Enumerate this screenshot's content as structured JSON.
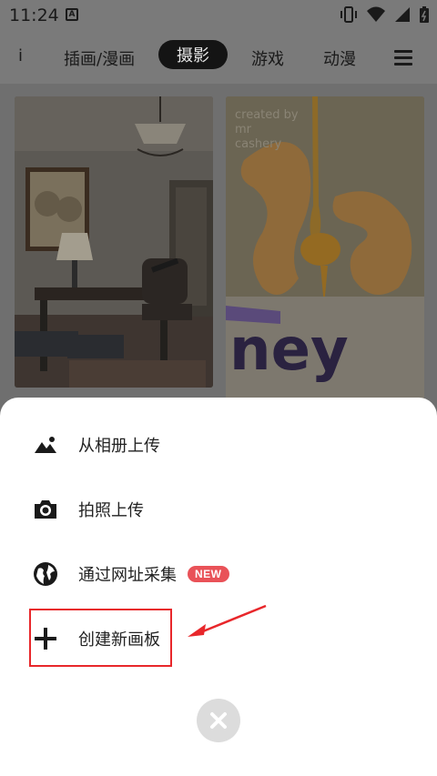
{
  "status_bar": {
    "time": "11:24",
    "notification_glyph": "A"
  },
  "tabs": {
    "partial_label": "i",
    "items": [
      {
        "label": "插画/漫画",
        "active": false
      },
      {
        "label": "摄影",
        "active": true
      },
      {
        "label": "游戏",
        "active": false
      },
      {
        "label": "动漫",
        "active": false
      }
    ]
  },
  "feed": {
    "cards": [
      {
        "kind": "photo",
        "subject": "study-room"
      },
      {
        "kind": "photo",
        "subject": "cashew-honey",
        "overlay_text": "created by\nmr\ncashery",
        "brand_text": "ney"
      }
    ]
  },
  "sheet": {
    "items": [
      {
        "label": "从相册上传",
        "icon": "image-mountain-icon"
      },
      {
        "label": "拍照上传",
        "icon": "camera-icon"
      },
      {
        "label": "通过网址采集",
        "icon": "globe-icon",
        "badge": "NEW"
      },
      {
        "label": "创建新画板",
        "icon": "plus-icon"
      }
    ]
  },
  "colors": {
    "overlay": "#6f6f6f",
    "sheet_bg": "#ffffff",
    "badge": "#e95258",
    "highlight": "#e8272b",
    "close_bg": "#dcdcdc"
  }
}
